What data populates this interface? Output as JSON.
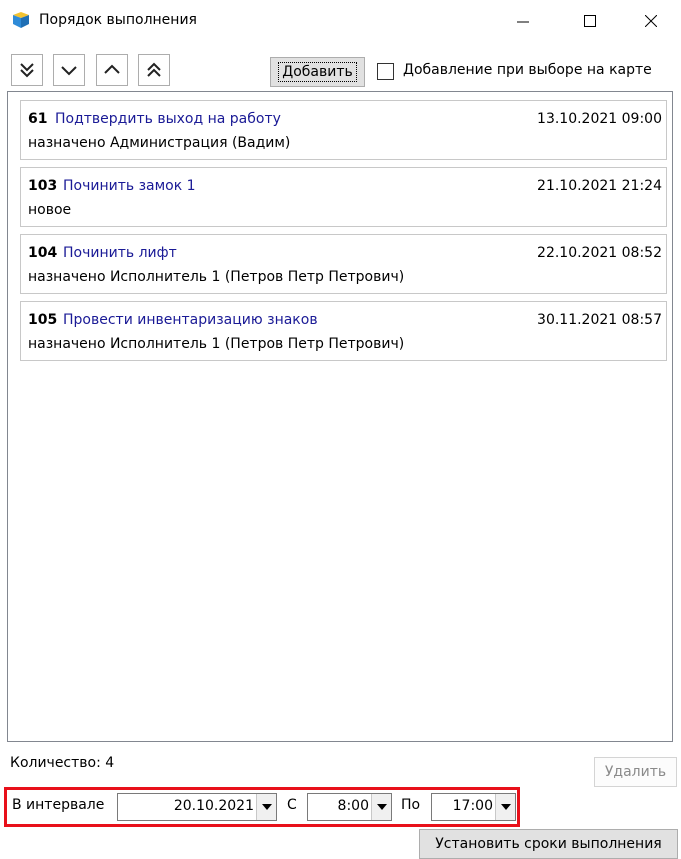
{
  "window": {
    "title": "Порядок выполнения"
  },
  "toolbar": {
    "add_label": "Добавить",
    "map_checkbox_label": "Добавление при выборе на карте",
    "map_checkbox_checked": false
  },
  "tasks": [
    {
      "id": "61",
      "title": "Подтвердить выход на работу",
      "date": "13.10.2021 09:00",
      "status": "назначено Администрация (Вадим)"
    },
    {
      "id": "103",
      "title": "Починить замок 1",
      "date": "21.10.2021 21:24",
      "status": "новое"
    },
    {
      "id": "104",
      "title": "Починить лифт",
      "date": "22.10.2021 08:52",
      "status": "назначено Исполнитель 1 (Петров Петр Петрович)"
    },
    {
      "id": "105",
      "title": "Провести инвентаризацию знаков",
      "date": "30.11.2021 08:57",
      "status": "назначено Исполнитель 1 (Петров Петр Петрович)"
    }
  ],
  "footer": {
    "count_label": "Количество: 4",
    "delete_label": "Удалить",
    "interval_label": "В интервале",
    "date_value": "20.10.2021",
    "from_label": "С",
    "from_value": "8:00",
    "to_label": "По",
    "to_value": "17:00",
    "set_label": "Установить сроки выполнения"
  },
  "colors": {
    "task_title": "#1a1a96",
    "highlight_border": "#e8101a",
    "app_icon_blue": "#2e8bd8",
    "app_icon_yellow": "#f2c230"
  },
  "icons": {
    "move_bottom": "double-chevron-down-icon",
    "move_down": "chevron-down-icon",
    "move_up": "chevron-up-icon",
    "move_top": "double-chevron-up-icon"
  }
}
